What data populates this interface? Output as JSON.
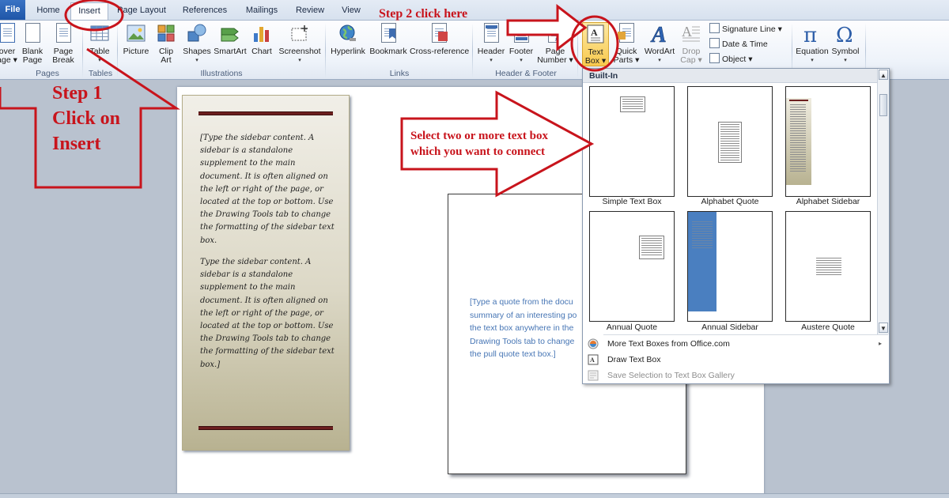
{
  "tabs": [
    {
      "label": "File"
    },
    {
      "label": "Home"
    },
    {
      "label": "Insert"
    },
    {
      "label": "Page Layout"
    },
    {
      "label": "References"
    },
    {
      "label": "Mailings"
    },
    {
      "label": "Review"
    },
    {
      "label": "View"
    }
  ],
  "ribbon": {
    "pages": {
      "cover": [
        "over",
        "age ▾"
      ],
      "blank": [
        "Blank",
        "Page"
      ],
      "break": [
        "Page",
        "Break"
      ],
      "group": "Pages"
    },
    "tables": {
      "table": "Table",
      "group": "Tables"
    },
    "illustrations": {
      "picture": "Picture",
      "clip": [
        "Clip",
        "Art"
      ],
      "shapes": "Shapes",
      "smartart": "SmartArt",
      "chart": "Chart",
      "screenshot": "Screenshot",
      "group": "Illustrations"
    },
    "links": {
      "hyperlink": "Hyperlink",
      "bookmark": "Bookmark",
      "crossref": "Cross-reference",
      "group": "Links"
    },
    "header_footer": {
      "header": "Header",
      "footer": "Footer",
      "page_number": [
        "Page",
        "Number ▾"
      ],
      "group": "Header & Footer"
    },
    "text": {
      "text_box": [
        "Text",
        "Box ▾"
      ],
      "quick_parts": [
        "Quick",
        "Parts ▾"
      ],
      "wordart": "WordArt",
      "drop_cap": [
        "Drop",
        "Cap ▾"
      ],
      "signature_line": "Signature Line ▾",
      "date_time": "Date & Time",
      "object": "Object ▾"
    },
    "symbols": {
      "equation": "Equation",
      "symbol": "Symbol"
    }
  },
  "document": {
    "sidebar_para_1": "[Type the sidebar content. A sidebar is a standalone supplement to the main document. It is often aligned on the left or right of the page, or located at the top or bottom. Use the Drawing Tools tab to change the formatting of the sidebar text box.",
    "sidebar_para_2": "Type the sidebar content. A sidebar is a standalone supplement to the main document. It is often aligned on the left or right of the page, or located at the top or bottom. Use the Drawing Tools tab to change the formatting of the sidebar text box.]",
    "quote_lines": [
      "[Type a quote from the docu",
      "summary of an interesting po",
      "the text box anywhere in the",
      "Drawing Tools tab to change",
      "the pull quote text box.]"
    ]
  },
  "gallery": {
    "heading": "Built-In",
    "items": [
      {
        "label": "Simple Text Box"
      },
      {
        "label": "Alphabet Quote"
      },
      {
        "label": "Alphabet Sidebar"
      },
      {
        "label": "Annual Quote"
      },
      {
        "label": "Annual Sidebar"
      },
      {
        "label": "Austere Quote"
      }
    ],
    "menu": [
      {
        "label": "More Text Boxes from Office.com"
      },
      {
        "label": "Draw Text Box"
      },
      {
        "label": "Save Selection to Text Box Gallery"
      }
    ]
  },
  "annotations": {
    "step1": [
      "Step 1",
      "Click on",
      "Insert"
    ],
    "step2": "Step 2 click here",
    "select_note": [
      "Select two or more text box",
      "which you want to connect"
    ]
  },
  "colors": {
    "annotation_red": "#c8141c",
    "accent_blue": "#2b579a",
    "sidebar_rule": "#6c1f1f",
    "quote_text": "#4776b5"
  }
}
